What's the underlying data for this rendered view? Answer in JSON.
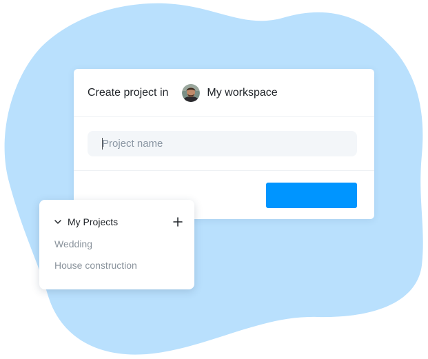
{
  "create_dialog": {
    "label": "Create project in",
    "workspace": {
      "name": "My workspace",
      "avatar": "user-avatar-photo"
    },
    "project_name_input": {
      "value": "",
      "placeholder": "Project name"
    },
    "create_button": {
      "label": ""
    }
  },
  "projects_panel": {
    "title": "My Projects",
    "expand_icon": "chevron-down-icon",
    "add_icon": "plus-icon",
    "items": [
      {
        "label": "Wedding"
      },
      {
        "label": "House construction"
      }
    ]
  },
  "colors": {
    "blob": "#b9e0fd",
    "primary_button": "#0095ff",
    "input_background": "#f3f6f9",
    "muted_text": "#8a939c"
  }
}
